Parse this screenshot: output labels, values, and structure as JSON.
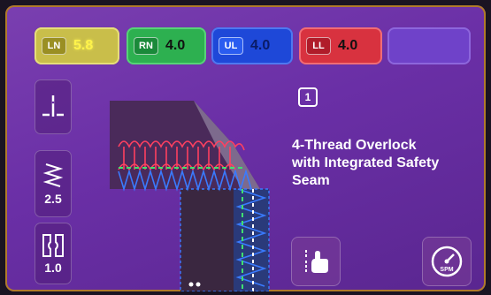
{
  "tension_chips": [
    {
      "id": "ln",
      "label": "LN",
      "value": "5.8",
      "color": "#c9be4a"
    },
    {
      "id": "rn",
      "label": "RN",
      "value": "4.0",
      "color": "#2db050"
    },
    {
      "id": "ul",
      "label": "UL",
      "value": "4.0",
      "color": "#1e48d8"
    },
    {
      "id": "ll",
      "label": "LL",
      "value": "4.0",
      "color": "#d8323f"
    }
  ],
  "empty_chip_color": "#6f42c9",
  "side_buttons": {
    "needle_icon": "needle-position-icon",
    "stitch_length_icon": "stitch-length-icon",
    "stitch_length_value": "2.5",
    "differential_icon": "differential-feed-icon",
    "differential_value": "1.0"
  },
  "program": {
    "number": "1",
    "name_line1": "4-Thread Overlock",
    "name_line2": "with Integrated Safety",
    "name_line3": "Seam"
  },
  "bottom_buttons": {
    "hand_icon": "hand-wheel-icon",
    "speed_icon": "speed-gauge-icon",
    "speed_label": "SPM"
  },
  "colors": {
    "background": "#6a2fa6",
    "thread_red": "#ff4060",
    "thread_blue": "#3a7bff",
    "thread_green": "#40e070"
  }
}
